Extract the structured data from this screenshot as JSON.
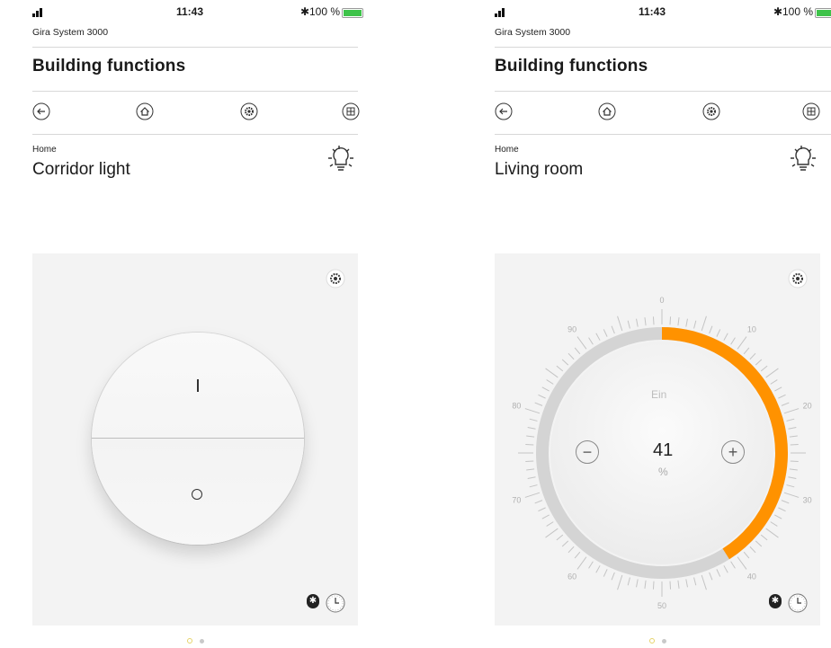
{
  "status_bar": {
    "time": "11:43",
    "bluetooth": "✱",
    "battery": "100 %",
    "charging": "⚡"
  },
  "app": {
    "system_name": "Gira System 3000",
    "section_title": "Building functions"
  },
  "nav": {
    "icons": [
      "back-arrow-icon",
      "home-icon",
      "settings-gear-icon",
      "grid-icon"
    ]
  },
  "screens": [
    {
      "breadcrumb": "Home",
      "title": "Corridor light",
      "control": {
        "type": "switch",
        "on_label": "I",
        "off_label": "O"
      },
      "footer_icons": [
        "bluetooth-icon",
        "clock-icon"
      ]
    },
    {
      "breadcrumb": "Home",
      "title": "Living room",
      "control": {
        "type": "dimmer",
        "status": "Ein",
        "value": "41",
        "unit": "%",
        "level": 41,
        "scale_labels": [
          "0",
          "10",
          "20",
          "30",
          "40",
          "50",
          "60",
          "70",
          "80",
          "90"
        ],
        "minus": "−",
        "plus": "+"
      },
      "footer_icons": [
        "bluetooth-icon",
        "clock-icon"
      ]
    }
  ],
  "pager": {
    "pages": 2,
    "active": 0
  },
  "colors": {
    "accent": "#ff9200",
    "track": "#d4d4d4",
    "panel": "#f3f3f3",
    "battery": "#3ec34a"
  }
}
